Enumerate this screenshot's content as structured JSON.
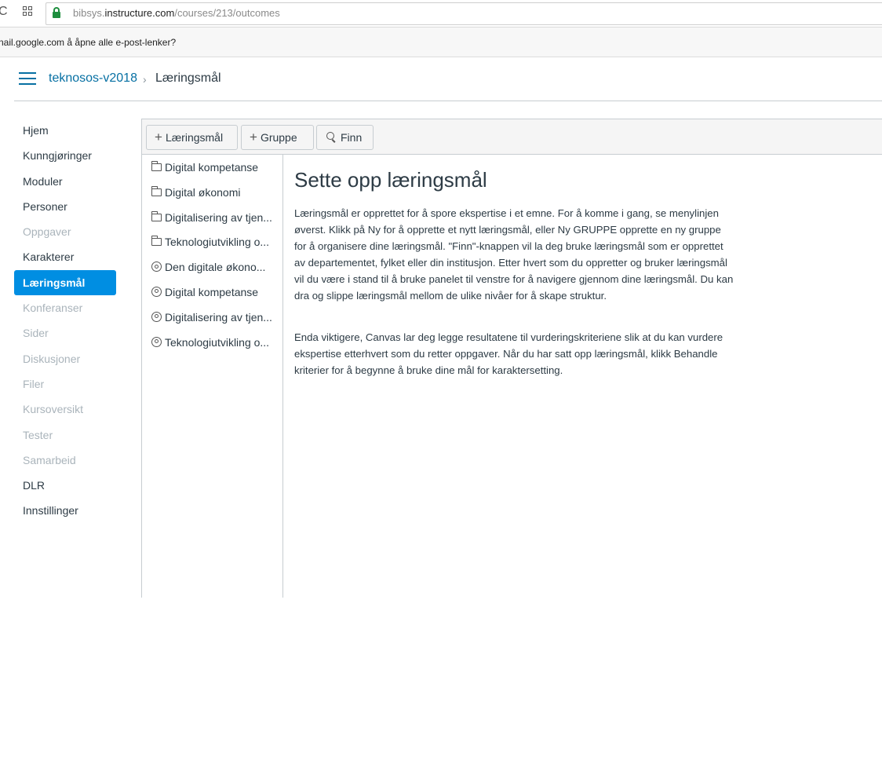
{
  "browser": {
    "url_domain_prefix": "bibsys.",
    "url_domain": "instructure.com",
    "url_path": "/courses/213/outcomes",
    "infobar_text": "nail.google.com å åpne alle e-post-lenker?"
  },
  "header": {
    "course_name": "teknosos-v2018",
    "separator": "›",
    "page_name": "Læringsmål"
  },
  "course_nav": {
    "items": [
      {
        "label": "Hjem",
        "state": "normal"
      },
      {
        "label": "Kunngjøringer",
        "state": "normal"
      },
      {
        "label": "Moduler",
        "state": "normal"
      },
      {
        "label": "Personer",
        "state": "normal"
      },
      {
        "label": "Oppgaver",
        "state": "muted"
      },
      {
        "label": "Karakterer",
        "state": "normal"
      },
      {
        "label": "Læringsmål",
        "state": "active"
      },
      {
        "label": "Konferanser",
        "state": "muted"
      },
      {
        "label": "Sider",
        "state": "muted"
      },
      {
        "label": "Diskusjoner",
        "state": "muted"
      },
      {
        "label": "Filer",
        "state": "muted"
      },
      {
        "label": "Kursoversikt",
        "state": "muted"
      },
      {
        "label": "Tester",
        "state": "muted"
      },
      {
        "label": "Samarbeid",
        "state": "muted"
      },
      {
        "label": "DLR",
        "state": "normal"
      },
      {
        "label": "Innstillinger",
        "state": "normal"
      }
    ]
  },
  "toolbar": {
    "add_outcome_label": "Læringsmål",
    "add_group_label": "Gruppe",
    "find_label": "Finn"
  },
  "tree": {
    "items": [
      {
        "label": "Digital kompetanse",
        "icon": "folder-icon"
      },
      {
        "label": "Digital økonomi",
        "icon": "folder-icon"
      },
      {
        "label": "Digitalisering av tjen...",
        "icon": "folder-icon"
      },
      {
        "label": "Teknologiutvikling o...",
        "icon": "folder-icon"
      },
      {
        "label": "Den digitale økono...",
        "icon": "outcome-target-icon"
      },
      {
        "label": "Digital kompetanse",
        "icon": "outcome-target-icon"
      },
      {
        "label": "Digitalisering av tjen...",
        "icon": "outcome-target-icon"
      },
      {
        "label": "Teknologiutvikling o...",
        "icon": "outcome-target-icon"
      }
    ]
  },
  "content": {
    "title": "Sette opp læringsmål",
    "paragraph1": "Læringsmål er opprettet for å spore ekspertise i et emne. For å komme i gang, se menylinjen øverst. Klikk på Ny for å opprette et nytt læringsmål, eller Ny GRUPPE opprette en ny gruppe for å organisere dine læringsmål. \"Finn\"-knappen vil la deg bruke læringsmål som er opprettet av departementet, fylket eller din institusjon. Etter hvert som du oppretter og bruker læringsmål vil du være i stand til å bruke panelet til venstre for å navigere gjennom dine læringsmål. Du kan dra og slippe læringsmål mellom de ulike nivåer for å skape struktur.",
    "paragraph2": "Enda viktigere, Canvas lar deg legge resultatene til vurderingskriteriene slik at du kan vurdere ekspertise etterhvert som du retter oppgaver. Når du har satt opp læringsmål, klikk Behandle kriterier for å begynne å bruke dine mål for karaktersetting."
  }
}
